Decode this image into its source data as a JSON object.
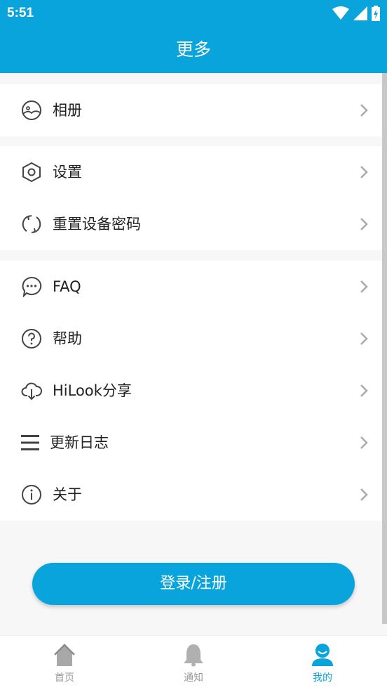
{
  "status_bar": {
    "time": "5:51"
  },
  "header": {
    "title": "更多"
  },
  "groups": [
    {
      "items": [
        {
          "label": "相册",
          "icon": "album-icon"
        }
      ]
    },
    {
      "items": [
        {
          "label": "设置",
          "icon": "settings-icon"
        },
        {
          "label": "重置设备密码",
          "icon": "reset-icon"
        }
      ]
    },
    {
      "items": [
        {
          "label": "FAQ",
          "icon": "faq-icon"
        },
        {
          "label": "帮助",
          "icon": "help-icon"
        },
        {
          "label": "HiLook分享",
          "icon": "cloud-download-icon"
        },
        {
          "label": "更新日志",
          "icon": "menu-list-icon"
        },
        {
          "label": "关于",
          "icon": "info-icon"
        }
      ]
    }
  ],
  "login_button": {
    "label": "登录/注册"
  },
  "tabs": [
    {
      "label": "首页",
      "icon": "home-icon"
    },
    {
      "label": "通知",
      "icon": "bell-icon"
    },
    {
      "label": "我的",
      "icon": "profile-icon",
      "active": true
    }
  ],
  "colors": {
    "accent": "#0aa4dd",
    "background": "#f7f7f7",
    "inactive_tab": "#999999"
  }
}
